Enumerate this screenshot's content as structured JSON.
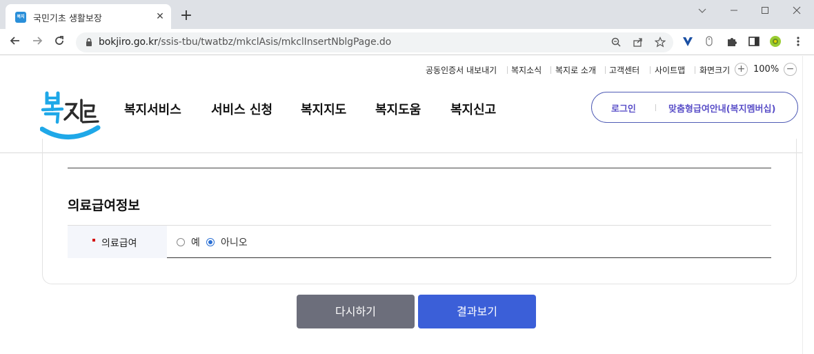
{
  "browser": {
    "tab_title": "국민기초 생활보장",
    "favicon_text": "복지",
    "new_tab": "+",
    "close_tab": "✕",
    "url_domain": "bokjiro.go.kr",
    "url_path": "/ssis-tbu/twatbz/mkclAsis/mkclInsertNblgPage.do"
  },
  "util_nav": {
    "items": [
      "공동인증서 내보내기",
      "복지소식",
      "복지로 소개",
      "고객센터",
      "사이트맵"
    ],
    "zoom_label": "화면크기",
    "zoom_in": "+",
    "zoom_value": "100%",
    "zoom_out": "−"
  },
  "gnb": {
    "items": [
      "복지서비스",
      "서비스 신청",
      "복지지도",
      "복지도움",
      "복지신고"
    ]
  },
  "member": {
    "login": "로그인",
    "membership": "맞춤형급여안내(복지멤버십)"
  },
  "section": {
    "title": "의료급여정보",
    "field_label": "의료급여",
    "options": [
      "예",
      "아니오"
    ],
    "selected": "아니오"
  },
  "actions": {
    "reset": "다시하기",
    "result": "결과보기"
  },
  "colors": {
    "accent": "#3b5fd8",
    "secondary": "#6c6e7b",
    "logo_blue": "#1fa8e8",
    "member_text": "#5a4fc8"
  }
}
